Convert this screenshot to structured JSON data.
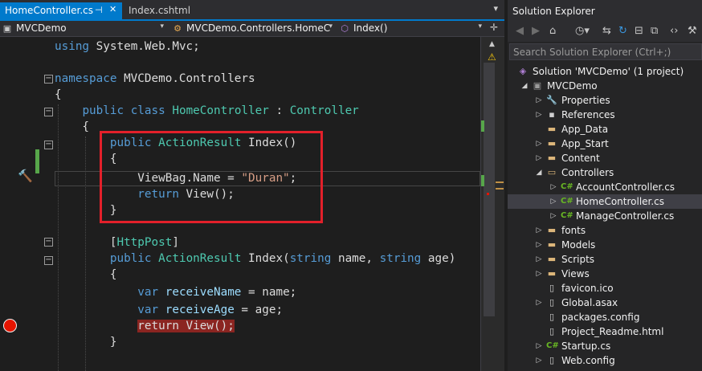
{
  "tabs": [
    {
      "label": "HomeController.cs",
      "pin": "⊣",
      "close": "✕",
      "active": true
    },
    {
      "label": "Index.cshtml",
      "active": false
    }
  ],
  "navbar": {
    "project": "MVCDemo",
    "class": "MVCDemo.Controllers.HomeC",
    "member": "Index()"
  },
  "code_lines": [
    {
      "tokens": [
        [
          "kw",
          "using"
        ],
        [
          "p",
          " System.Web.Mvc;"
        ]
      ]
    },
    {
      "tokens": []
    },
    {
      "tokens": [
        [
          "kw",
          "namespace"
        ],
        [
          "p",
          " MVCDemo.Controllers"
        ]
      ]
    },
    {
      "tokens": [
        [
          "p",
          "{"
        ]
      ]
    },
    {
      "tokens": [
        [
          "p",
          "    "
        ],
        [
          "kw",
          "public"
        ],
        [
          "p",
          " "
        ],
        [
          "kw",
          "class"
        ],
        [
          "p",
          " "
        ],
        [
          "ty",
          "HomeController"
        ],
        [
          "p",
          " : "
        ],
        [
          "ty",
          "Controller"
        ]
      ]
    },
    {
      "tokens": [
        [
          "p",
          "    {"
        ]
      ]
    },
    {
      "tokens": [
        [
          "p",
          "        "
        ],
        [
          "kw",
          "public"
        ],
        [
          "p",
          " "
        ],
        [
          "ty",
          "ActionResult"
        ],
        [
          "p",
          " Index()"
        ]
      ]
    },
    {
      "tokens": [
        [
          "p",
          "        {"
        ]
      ]
    },
    {
      "tokens": [
        [
          "p",
          "            ViewBag.Name = "
        ],
        [
          "st",
          "\"Duran\""
        ],
        [
          "p",
          ";"
        ]
      ]
    },
    {
      "tokens": [
        [
          "p",
          "            "
        ],
        [
          "kw",
          "return"
        ],
        [
          "p",
          " View();"
        ]
      ]
    },
    {
      "tokens": [
        [
          "p",
          "        }"
        ]
      ]
    },
    {
      "tokens": []
    },
    {
      "tokens": [
        [
          "p",
          "        ["
        ],
        [
          "ty",
          "HttpPost"
        ],
        [
          "p",
          "]"
        ]
      ]
    },
    {
      "tokens": [
        [
          "p",
          "        "
        ],
        [
          "kw",
          "public"
        ],
        [
          "p",
          " "
        ],
        [
          "ty",
          "ActionResult"
        ],
        [
          "p",
          " Index("
        ],
        [
          "kw",
          "string"
        ],
        [
          "p",
          " name, "
        ],
        [
          "kw",
          "string"
        ],
        [
          "p",
          " age)"
        ]
      ]
    },
    {
      "tokens": [
        [
          "p",
          "        {"
        ]
      ]
    },
    {
      "tokens": [
        [
          "p",
          "            "
        ],
        [
          "kw",
          "var"
        ],
        [
          "p",
          " "
        ],
        [
          "vr",
          "receiveName"
        ],
        [
          "p",
          " = name;"
        ]
      ]
    },
    {
      "tokens": [
        [
          "p",
          "            "
        ],
        [
          "kw",
          "var"
        ],
        [
          "p",
          " "
        ],
        [
          "vr",
          "receiveAge"
        ],
        [
          "p",
          " = age;"
        ]
      ]
    },
    {
      "tokens": [
        [
          "p",
          "            "
        ],
        [
          "bp",
          "return View();"
        ]
      ]
    },
    {
      "tokens": [
        [
          "p",
          "        }"
        ]
      ]
    }
  ],
  "solution_explorer": {
    "title": "Solution Explorer",
    "search_placeholder": "Search Solution Explorer (Ctrl+;)",
    "items": [
      {
        "label": "Solution 'MVCDemo' (1 project)",
        "icon": "solution-icon",
        "depth": 0,
        "arrow": ""
      },
      {
        "label": "MVCDemo",
        "icon": "project-icon",
        "depth": 1,
        "arrow": "expanded"
      },
      {
        "label": "Properties",
        "icon": "wrench-icon",
        "depth": 2,
        "arrow": "collapsed"
      },
      {
        "label": "References",
        "icon": "references-icon",
        "depth": 2,
        "arrow": "collapsed"
      },
      {
        "label": "App_Data",
        "icon": "folder-icon",
        "depth": 2,
        "arrow": ""
      },
      {
        "label": "App_Start",
        "icon": "folder-icon",
        "depth": 2,
        "arrow": "collapsed"
      },
      {
        "label": "Content",
        "icon": "folder-icon",
        "depth": 2,
        "arrow": "collapsed"
      },
      {
        "label": "Controllers",
        "icon": "folder-open-icon",
        "depth": 2,
        "arrow": "expanded"
      },
      {
        "label": "AccountController.cs",
        "icon": "csharp-file-icon",
        "depth": 3,
        "arrow": "collapsed"
      },
      {
        "label": "HomeController.cs",
        "icon": "csharp-file-icon",
        "depth": 3,
        "arrow": "collapsed",
        "selected": true
      },
      {
        "label": "ManageController.cs",
        "icon": "csharp-file-icon",
        "depth": 3,
        "arrow": "collapsed"
      },
      {
        "label": "fonts",
        "icon": "folder-icon",
        "depth": 2,
        "arrow": "collapsed"
      },
      {
        "label": "Models",
        "icon": "folder-icon",
        "depth": 2,
        "arrow": "collapsed"
      },
      {
        "label": "Scripts",
        "icon": "folder-icon",
        "depth": 2,
        "arrow": "collapsed"
      },
      {
        "label": "Views",
        "icon": "folder-icon",
        "depth": 2,
        "arrow": "collapsed"
      },
      {
        "label": "favicon.ico",
        "icon": "file-icon",
        "depth": 2,
        "arrow": ""
      },
      {
        "label": "Global.asax",
        "icon": "file-icon",
        "depth": 2,
        "arrow": "collapsed"
      },
      {
        "label": "packages.config",
        "icon": "file-icon",
        "depth": 2,
        "arrow": ""
      },
      {
        "label": "Project_Readme.html",
        "icon": "file-icon",
        "depth": 2,
        "arrow": ""
      },
      {
        "label": "Startup.cs",
        "icon": "csharp-file-icon",
        "depth": 2,
        "arrow": "collapsed"
      },
      {
        "label": "Web.config",
        "icon": "file-icon",
        "depth": 2,
        "arrow": "collapsed"
      }
    ]
  },
  "colors": {
    "accent": "#007acc",
    "highlight_box": "#e3202a",
    "breakpoint": "#e51400",
    "keyword": "#569cd6",
    "type": "#4ec9b0",
    "string": "#d69d85"
  }
}
